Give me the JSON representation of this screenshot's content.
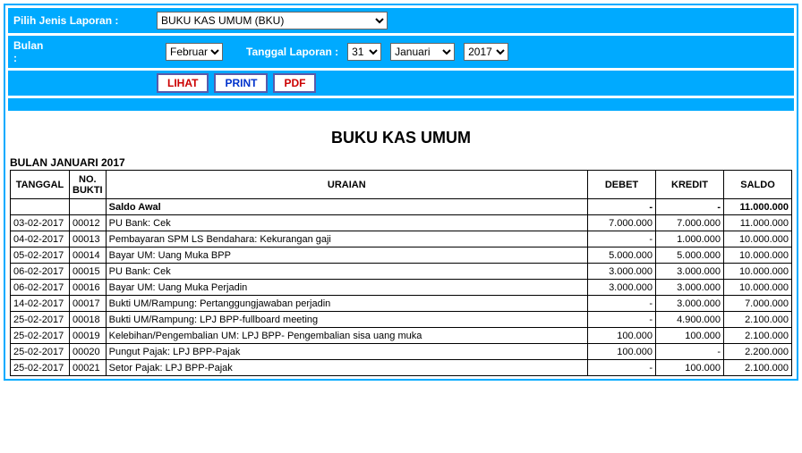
{
  "filters": {
    "jenis_label": "Pilih Jenis Laporan :",
    "jenis_value": "BUKU KAS UMUM (BKU)",
    "bulan_label": "Bulan :",
    "bulan_value": "Februari",
    "tanggal_label": "Tanggal Laporan :",
    "tanggal_day": "31",
    "tanggal_month": "Januari",
    "tanggal_year": "2017"
  },
  "buttons": {
    "lihat": "LIHAT",
    "print": "PRINT",
    "pdf": "PDF"
  },
  "report": {
    "title": "BUKU KAS UMUM",
    "subtitle": "BULAN JANUARI 2017",
    "headers": {
      "tanggal": "TANGGAL",
      "no_bukti": "NO. BUKTI",
      "uraian": "URAIAN",
      "debet": "DEBET",
      "kredit": "KREDIT",
      "saldo": "SALDO"
    },
    "rows": [
      {
        "tanggal": "",
        "no": "",
        "uraian": "Saldo Awal",
        "debet": "-",
        "kredit": "-",
        "saldo": "11.000.000"
      },
      {
        "tanggal": "03-02-2017",
        "no": "00012",
        "uraian": "PU Bank: Cek",
        "debet": "7.000.000",
        "kredit": "7.000.000",
        "saldo": "11.000.000"
      },
      {
        "tanggal": "04-02-2017",
        "no": "00013",
        "uraian": "Pembayaran SPM LS Bendahara: Kekurangan gaji",
        "debet": "-",
        "kredit": "1.000.000",
        "saldo": "10.000.000"
      },
      {
        "tanggal": "05-02-2017",
        "no": "00014",
        "uraian": "Bayar UM: Uang Muka BPP",
        "debet": "5.000.000",
        "kredit": "5.000.000",
        "saldo": "10.000.000"
      },
      {
        "tanggal": "06-02-2017",
        "no": "00015",
        "uraian": "PU Bank: Cek",
        "debet": "3.000.000",
        "kredit": "3.000.000",
        "saldo": "10.000.000"
      },
      {
        "tanggal": "06-02-2017",
        "no": "00016",
        "uraian": "Bayar UM: Uang Muka Perjadin",
        "debet": "3.000.000",
        "kredit": "3.000.000",
        "saldo": "10.000.000"
      },
      {
        "tanggal": "14-02-2017",
        "no": "00017",
        "uraian": "Bukti UM/Rampung: Pertanggungjawaban perjadin",
        "debet": "-",
        "kredit": "3.000.000",
        "saldo": "7.000.000"
      },
      {
        "tanggal": "25-02-2017",
        "no": "00018",
        "uraian": "Bukti UM/Rampung: LPJ BPP-fullboard meeting",
        "debet": "-",
        "kredit": "4.900.000",
        "saldo": "2.100.000"
      },
      {
        "tanggal": "25-02-2017",
        "no": "00019",
        "uraian": "Kelebihan/Pengembalian UM: LPJ BPP- Pengembalian sisa uang muka",
        "debet": "100.000",
        "kredit": "100.000",
        "saldo": "2.100.000"
      },
      {
        "tanggal": "25-02-2017",
        "no": "00020",
        "uraian": "Pungut Pajak: LPJ BPP-Pajak",
        "debet": "100.000",
        "kredit": "-",
        "saldo": "2.200.000"
      },
      {
        "tanggal": "25-02-2017",
        "no": "00021",
        "uraian": "Setor Pajak: LPJ BPP-Pajak",
        "debet": "-",
        "kredit": "100.000",
        "saldo": "2.100.000"
      }
    ]
  }
}
